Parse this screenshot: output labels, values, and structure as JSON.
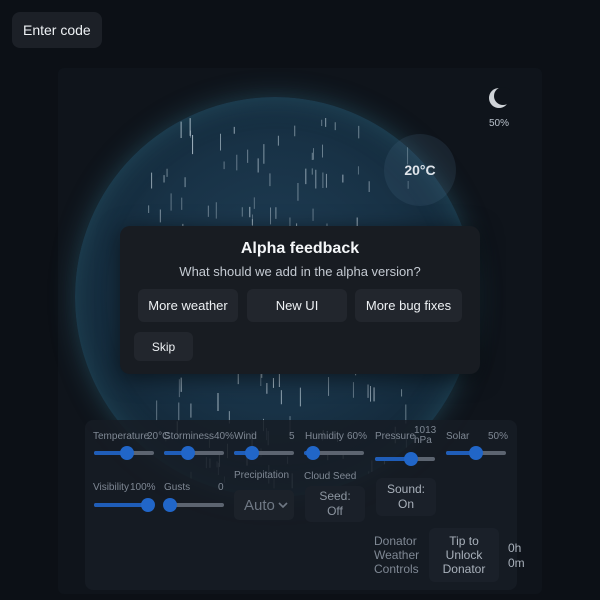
{
  "topbar": {
    "enter_code_label": "Enter code"
  },
  "sky": {
    "moon_icon": "moon-icon",
    "moon_percent": "50%",
    "temperature_display": "20°C"
  },
  "dialog": {
    "title": "Alpha feedback",
    "question": "What should we add in the alpha version?",
    "options": [
      "More weather",
      "New UI",
      "More bug fixes"
    ],
    "skip_label": "Skip"
  },
  "controls": {
    "temperature": {
      "label": "Temperature",
      "value_text": "20°C",
      "level": 0.55
    },
    "storminess": {
      "label": "Storminess",
      "value_text": "40%",
      "level": 0.4
    },
    "wind": {
      "label": "Wind",
      "value_text": "5",
      "level": 0.3
    },
    "humidity": {
      "label": "Humidity",
      "value_text": "60%",
      "level": 0.15
    },
    "pressure": {
      "label": "Pressure",
      "value_text": "1013 hPa",
      "level": 0.6
    },
    "solar": {
      "label": "Solar",
      "value_text": "50%",
      "level": 0.5
    },
    "visibility": {
      "label": "Visibility",
      "value_text": "100%",
      "level": 1.0
    },
    "gusts": {
      "label": "Gusts",
      "value_text": "0",
      "level": 0.0
    },
    "precipitation": {
      "label": "Precipitation",
      "selected": "Auto"
    },
    "cloud_seed": {
      "label": "Cloud Seed",
      "button_label": "Seed: Off"
    },
    "sound": {
      "button_label": "Sound: On"
    },
    "donator": {
      "label": "Donator Weather Controls",
      "tip_button_label": "Tip to Unlock Donator",
      "timer": "0h 0m"
    }
  },
  "colors": {
    "accent": "#2166c8",
    "background": "#0c1016",
    "dialog": "#181c22"
  }
}
